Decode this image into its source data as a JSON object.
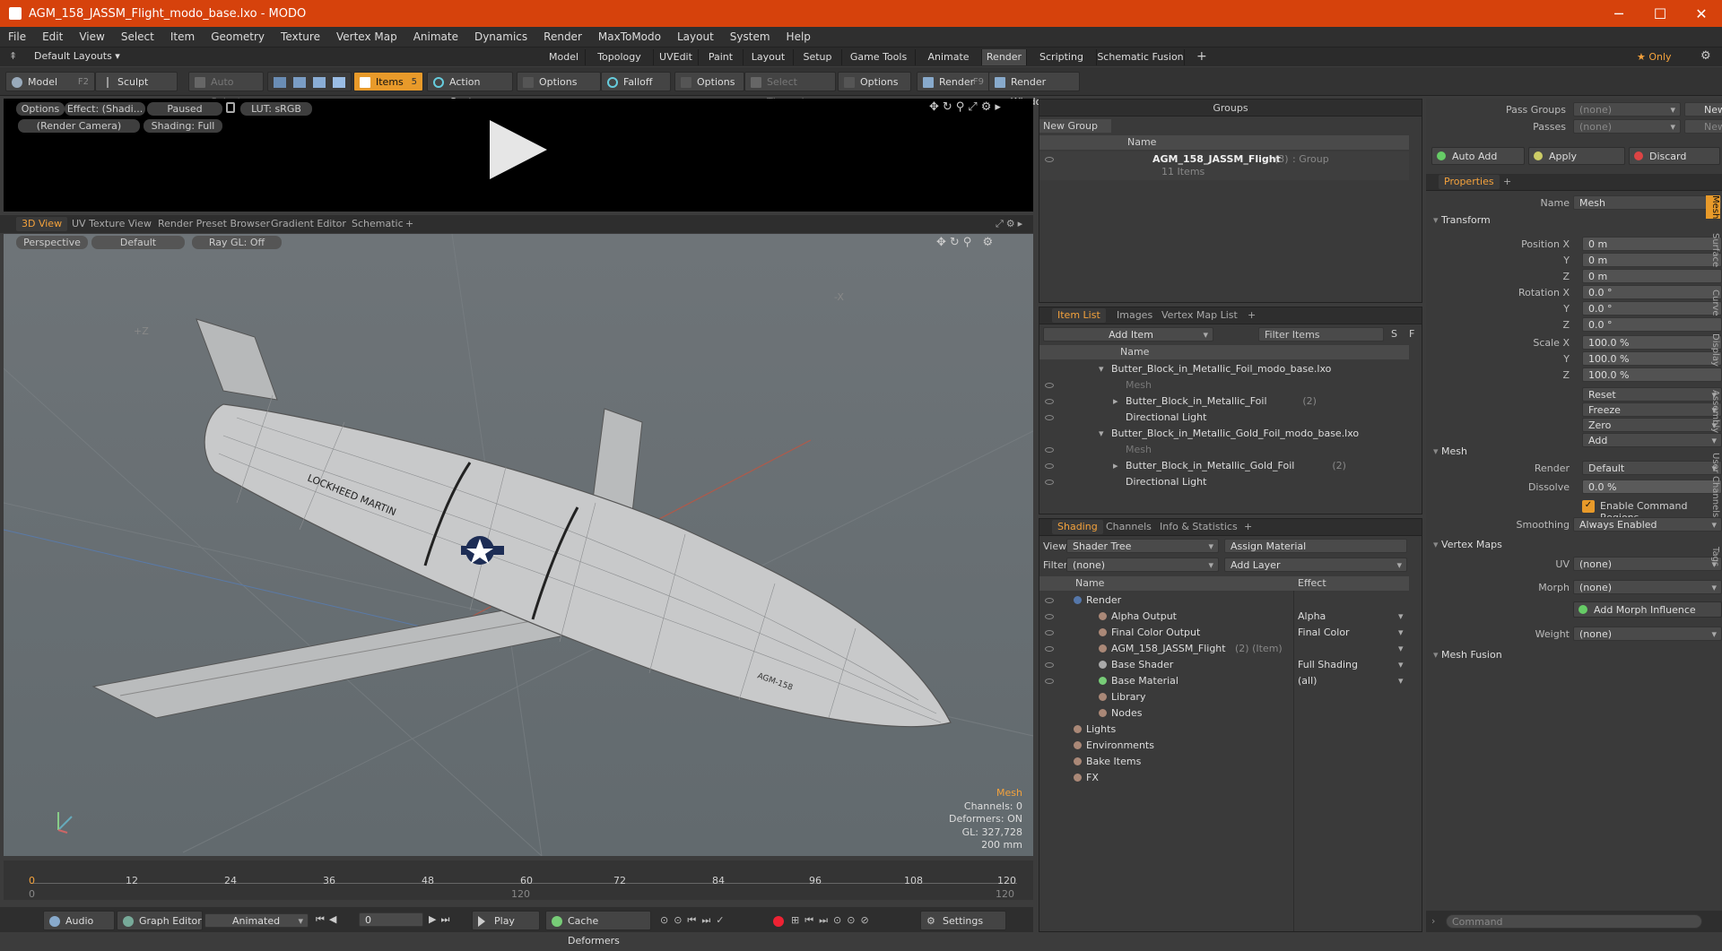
{
  "window": {
    "title": "AGM_158_JASSM_Flight_modo_base.lxo - MODO",
    "minimize": "─",
    "maximize": "☐",
    "close": "✕"
  },
  "menu": [
    "File",
    "Edit",
    "View",
    "Select",
    "Item",
    "Geometry",
    "Texture",
    "Vertex Map",
    "Animate",
    "Dynamics",
    "Render",
    "MaxToModo",
    "Layout",
    "System",
    "Help"
  ],
  "layouts": {
    "default": "Default Layouts ▾",
    "tabs": [
      "Model",
      "Topology",
      "UVEdit",
      "Paint",
      "Layout",
      "Setup",
      "Game Tools",
      "Animate",
      "Render",
      "Scripting",
      "Schematic Fusion"
    ],
    "active": "Render",
    "plus": "+",
    "only": "★ Only"
  },
  "toolbar": {
    "model": "Model",
    "model_key": "F2",
    "sculpt": "Sculpt",
    "auto_select": "Auto Select",
    "items": "Items",
    "items_key": "5",
    "action_center": "Action Center",
    "options1": "Options",
    "falloff": "Falloff",
    "options2": "Options",
    "select_through": "Select Through",
    "options3": "Options",
    "render": "Render",
    "render_key": "F9",
    "render_window": "Render Window"
  },
  "preview": {
    "options": "Options",
    "effect": "Effect: (Shadi...",
    "paused": "Paused",
    "lut": "LUT: sRGB",
    "camera": "(Render Camera)",
    "shading": "Shading: Full"
  },
  "viewtabs": {
    "tabs": [
      "3D View",
      "UV Texture View",
      "Render Preset Browser",
      "Gradient Editor",
      "Schematic"
    ],
    "plus": "+"
  },
  "viewport": {
    "perspective": "Perspective",
    "default": "Default",
    "raygl": "Ray GL: Off",
    "axis_z": "+Z",
    "axis_x": "-X",
    "logo_text": "LOCKHEED MARTIN",
    "body_text": "AGM-158",
    "info": {
      "mesh": "Mesh",
      "channels": "Channels: 0",
      "deformers": "Deformers: ON",
      "gl": "GL: 327,728",
      "scale": "200 mm"
    }
  },
  "timeline": {
    "ticks": [
      "0",
      "12",
      "24",
      "36",
      "48",
      "60",
      "72",
      "84",
      "96",
      "108",
      "120"
    ],
    "sub": [
      "0",
      "120",
      "120"
    ]
  },
  "bottombar": {
    "audio": "Audio",
    "graph_editor": "Graph Editor",
    "animated": "Animated",
    "frame": "0",
    "play": "Play",
    "cache": "Cache Deformers",
    "settings": "Settings"
  },
  "groups": {
    "title": "Groups",
    "new_group": "New Group",
    "col_name": "Name",
    "item_name": "AGM_158_JASSM_Flight",
    "item_count": "(3)",
    "item_kind": ": Group",
    "item_sub": "11 Items"
  },
  "itemlist": {
    "tabs": [
      "Item List",
      "Images",
      "Vertex Map List"
    ],
    "plus": "+",
    "add_item": "Add Item",
    "filter": "Filter Items",
    "s": "S",
    "f": "F",
    "col_name": "Name",
    "rows": [
      {
        "label": "Butter_Block_in_Metallic_Foil_modo_base.lxo",
        "indent": 0,
        "arrow": "▾",
        "dim": false
      },
      {
        "label": "Mesh",
        "indent": 1,
        "arrow": "",
        "dim": true
      },
      {
        "label": "Butter_Block_in_Metallic_Foil",
        "extra": "(2)",
        "indent": 1,
        "arrow": "▸",
        "dim": false
      },
      {
        "label": "Directional Light",
        "indent": 1,
        "arrow": "",
        "dim": false
      },
      {
        "label": "Butter_Block_in_Metallic_Gold_Foil_modo_base.lxo",
        "indent": 0,
        "arrow": "▾",
        "dim": false
      },
      {
        "label": "Mesh",
        "indent": 1,
        "arrow": "",
        "dim": true
      },
      {
        "label": "Butter_Block_in_Metallic_Gold_Foil",
        "extra": "(2)",
        "indent": 1,
        "arrow": "▸",
        "dim": false
      },
      {
        "label": "Directional Light",
        "indent": 1,
        "arrow": "",
        "dim": false
      }
    ]
  },
  "shading": {
    "tabs": [
      "Shading",
      "Channels",
      "Info & Statistics"
    ],
    "plus": "+",
    "view_label": "View",
    "view": "Shader Tree",
    "assign": "Assign Material",
    "filter_label": "Filter",
    "filter": "(none)",
    "add_layer": "Add Layer",
    "col_name": "Name",
    "col_effect": "Effect",
    "rows": [
      {
        "label": "Render",
        "effect": "",
        "indent": 0
      },
      {
        "label": "Alpha Output",
        "effect": "Alpha",
        "indent": 1
      },
      {
        "label": "Final Color Output",
        "effect": "Final Color",
        "indent": 1
      },
      {
        "label": "AGM_158_JASSM_Flight",
        "extra": "(2) (Item)",
        "effect": "",
        "indent": 1
      },
      {
        "label": "Base Shader",
        "effect": "Full Shading",
        "indent": 1
      },
      {
        "label": "Base Material",
        "effect": "(all)",
        "indent": 1
      },
      {
        "label": "Library",
        "effect": "",
        "indent": 1
      },
      {
        "label": "Nodes",
        "effect": "",
        "indent": 1
      },
      {
        "label": "Lights",
        "effect": "",
        "indent": 0
      },
      {
        "label": "Environments",
        "effect": "",
        "indent": 0
      },
      {
        "label": "Bake Items",
        "effect": "",
        "indent": 0
      },
      {
        "label": "FX",
        "effect": "",
        "indent": 0
      }
    ]
  },
  "passes": {
    "pass_groups": "Pass Groups",
    "passes": "Passes",
    "none": "(none)",
    "new": "New",
    "auto_add": "Auto Add",
    "apply": "Apply",
    "discard": "Discard"
  },
  "properties": {
    "tab": "Properties",
    "plus": "+",
    "name_label": "Name",
    "name": "Mesh",
    "transform": "Transform",
    "pos_labels": [
      "Position X",
      "Y",
      "Z"
    ],
    "pos": [
      "0 m",
      "0 m",
      "0 m"
    ],
    "rot_labels": [
      "Rotation X",
      "Y",
      "Z"
    ],
    "rot": [
      "0.0 °",
      "0.0 °",
      "0.0 °"
    ],
    "scale_labels": [
      "Scale X",
      "Y",
      "Z"
    ],
    "scale": [
      "100.0 %",
      "100.0 %",
      "100.0 %"
    ],
    "actions": [
      "Reset",
      "Freeze",
      "Zero",
      "Add"
    ],
    "mesh": "Mesh",
    "render_label": "Render",
    "render": "Default",
    "dissolve_label": "Dissolve",
    "dissolve": "0.0 %",
    "ecr": "Enable Command Regions",
    "smoothing_label": "Smoothing",
    "smoothing": "Always Enabled",
    "vertex_maps": "Vertex Maps",
    "uv_label": "UV",
    "uv": "(none)",
    "morph_label": "Morph",
    "morph": "(none)",
    "add_morph": "Add Morph Influence",
    "weight_label": "Weight",
    "weight": "(none)",
    "mesh_fusion": "Mesh Fusion",
    "side_tabs": [
      "Mesh",
      "Surface",
      "Curve",
      "Display",
      "Assembly",
      "User Channels",
      "Tags"
    ]
  },
  "command": {
    "placeholder": "Command"
  }
}
